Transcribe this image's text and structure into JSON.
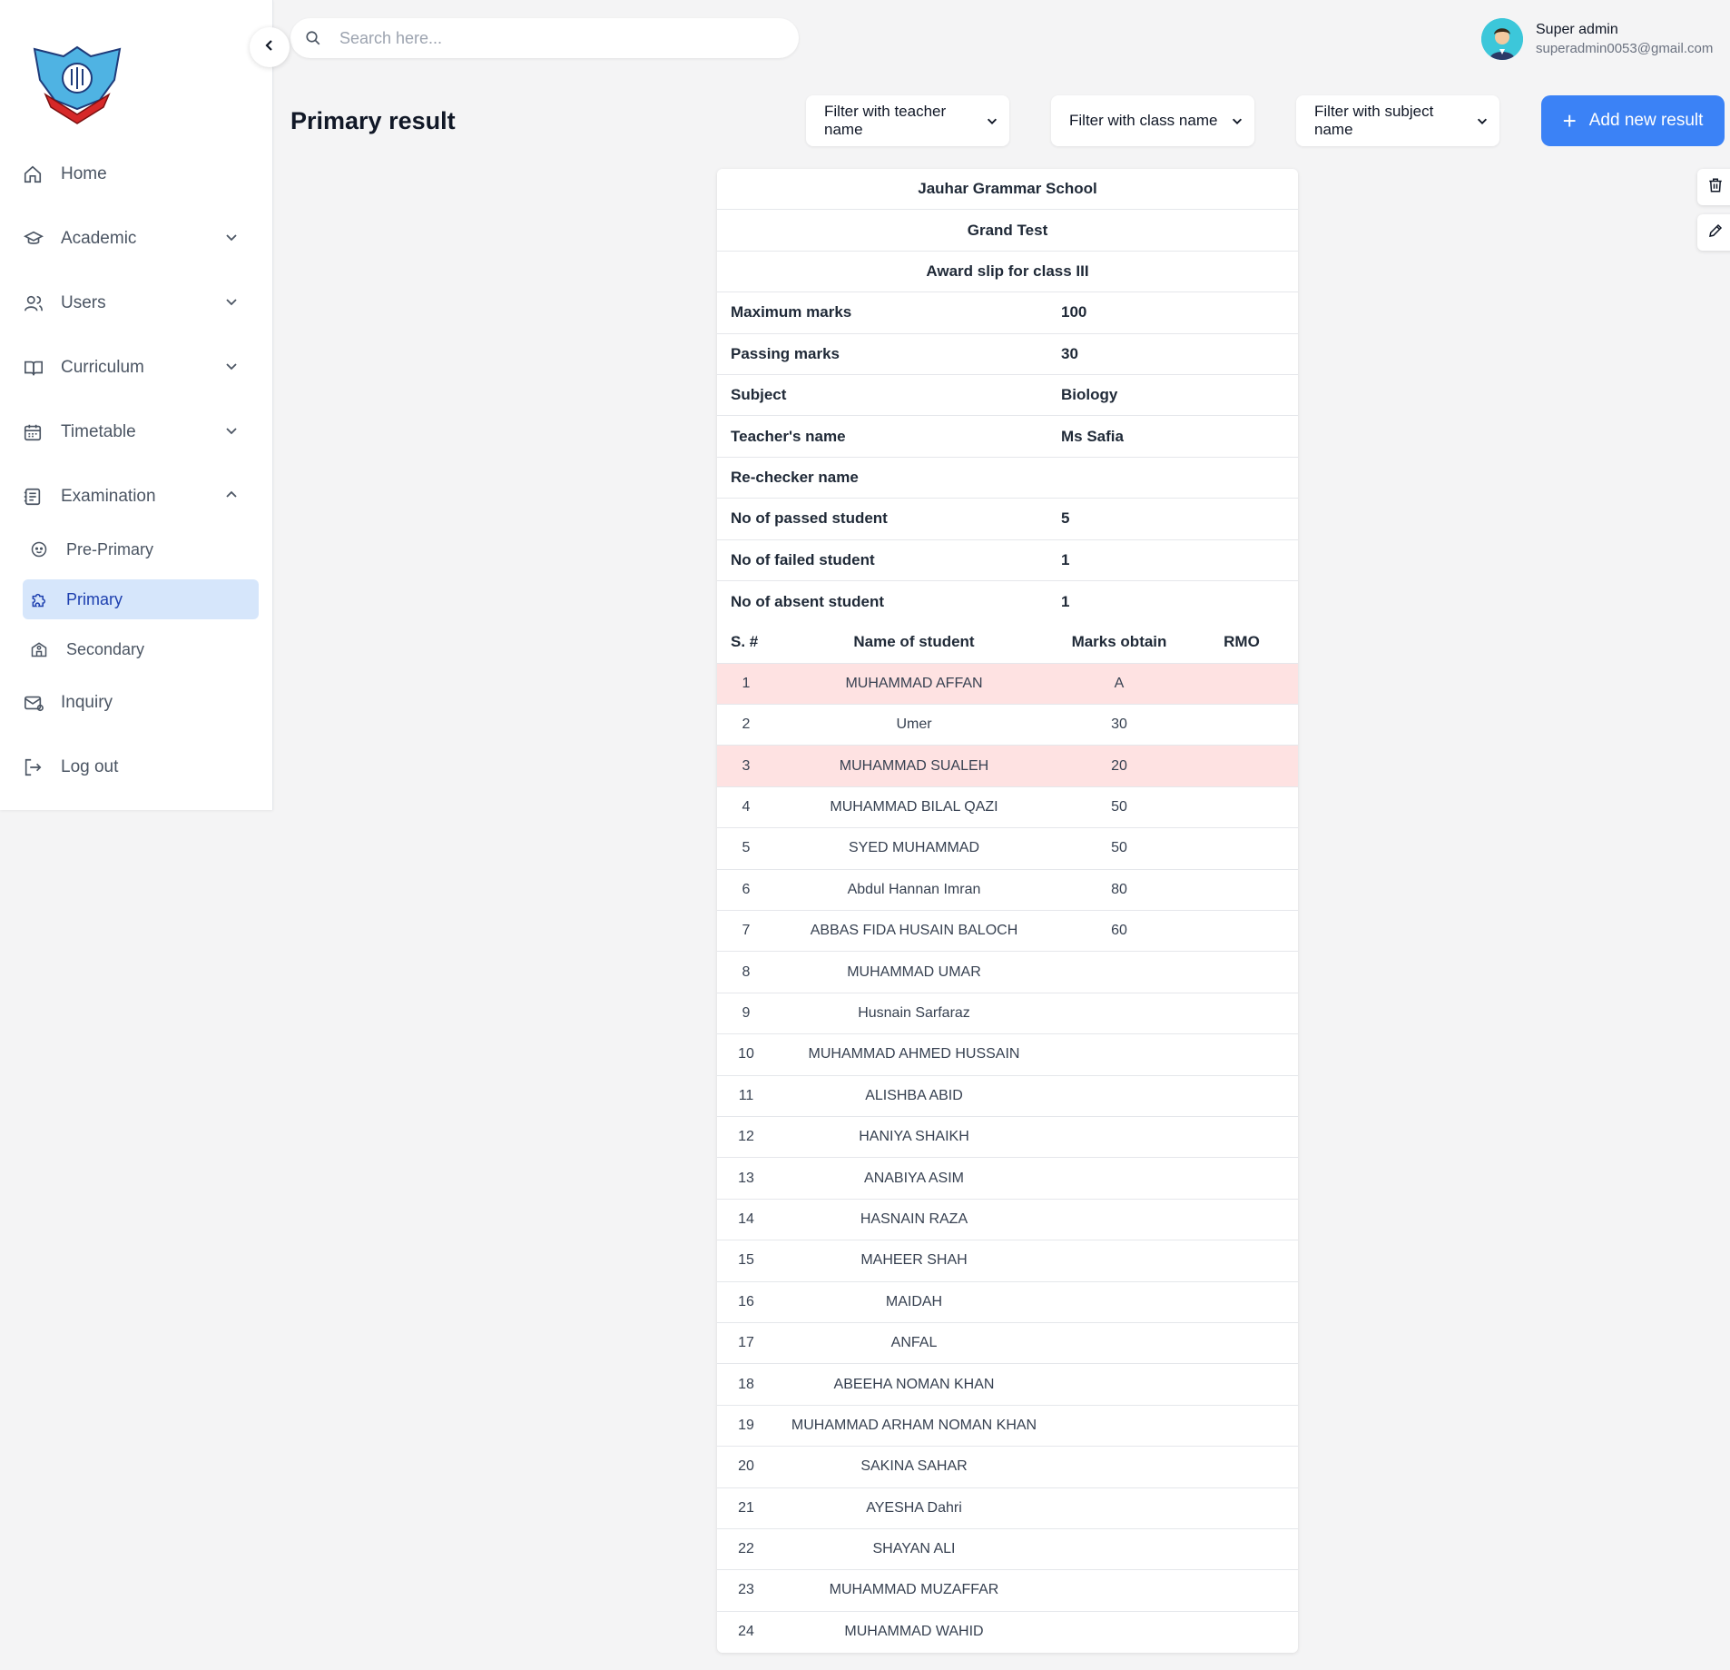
{
  "search": {
    "placeholder": "Search here..."
  },
  "profile": {
    "name": "Super admin",
    "email": "superadmin0053@gmail.com"
  },
  "sidebar": {
    "items": [
      {
        "label": "Home",
        "icon": "home-icon"
      },
      {
        "label": "Academic",
        "icon": "graduation-cap-icon"
      },
      {
        "label": "Users",
        "icon": "users-icon"
      },
      {
        "label": "Curriculum",
        "icon": "book-icon"
      },
      {
        "label": "Timetable",
        "icon": "calendar-icon"
      },
      {
        "label": "Examination",
        "icon": "notebook-icon",
        "expanded": true
      },
      {
        "label": "Inquiry",
        "icon": "mail-icon"
      },
      {
        "label": "Log out",
        "icon": "logout-icon"
      }
    ],
    "examination_sub": [
      {
        "label": "Pre-Primary",
        "icon": "baby-icon"
      },
      {
        "label": "Primary",
        "icon": "puzzle-icon",
        "active": true
      },
      {
        "label": "Secondary",
        "icon": "school-building-icon"
      }
    ]
  },
  "page": {
    "title": "Primary result"
  },
  "filters": {
    "teacher": "Filter with teacher name",
    "class": "Filter with class name",
    "subject": "Filter with subject name"
  },
  "add_button": {
    "label": "Add new result"
  },
  "result": {
    "school": "Jauhar Grammar School",
    "test": "Grand Test",
    "slip": "Award slip for class III",
    "info": [
      {
        "label": "Maximum marks",
        "value": "100"
      },
      {
        "label": "Passing marks",
        "value": "30"
      },
      {
        "label": "Subject",
        "value": "Biology"
      },
      {
        "label": "Teacher's name",
        "value": "Ms Safia"
      },
      {
        "label": "Re-checker name",
        "value": ""
      },
      {
        "label": "No of passed student",
        "value": "5"
      },
      {
        "label": "No of failed student",
        "value": "1"
      },
      {
        "label": "No of absent student",
        "value": "1"
      }
    ],
    "headers": {
      "sno": "S. #",
      "name": "Name of student",
      "marks": "Marks obtain",
      "rmo": "RMO"
    },
    "students": [
      {
        "sno": "1",
        "name": "MUHAMMAD AFFAN",
        "marks": "A",
        "rmo": "",
        "highlight": true
      },
      {
        "sno": "2",
        "name": "Umer",
        "marks": "30",
        "rmo": ""
      },
      {
        "sno": "3",
        "name": "MUHAMMAD SUALEH",
        "marks": "20",
        "rmo": "",
        "highlight": true
      },
      {
        "sno": "4",
        "name": "MUHAMMAD BILAL QAZI",
        "marks": "50",
        "rmo": ""
      },
      {
        "sno": "5",
        "name": "SYED MUHAMMAD",
        "marks": "50",
        "rmo": ""
      },
      {
        "sno": "6",
        "name": "Abdul Hannan Imran",
        "marks": "80",
        "rmo": ""
      },
      {
        "sno": "7",
        "name": "ABBAS FIDA HUSAIN BALOCH",
        "marks": "60",
        "rmo": ""
      },
      {
        "sno": "8",
        "name": "MUHAMMAD UMAR",
        "marks": "",
        "rmo": ""
      },
      {
        "sno": "9",
        "name": "Husnain Sarfaraz",
        "marks": "",
        "rmo": ""
      },
      {
        "sno": "10",
        "name": "MUHAMMAD AHMED HUSSAIN",
        "marks": "",
        "rmo": ""
      },
      {
        "sno": "11",
        "name": "ALISHBA ABID",
        "marks": "",
        "rmo": ""
      },
      {
        "sno": "12",
        "name": "HANIYA SHAIKH",
        "marks": "",
        "rmo": ""
      },
      {
        "sno": "13",
        "name": "ANABIYA ASIM",
        "marks": "",
        "rmo": ""
      },
      {
        "sno": "14",
        "name": "HASNAIN RAZA",
        "marks": "",
        "rmo": ""
      },
      {
        "sno": "15",
        "name": "MAHEER SHAH",
        "marks": "",
        "rmo": ""
      },
      {
        "sno": "16",
        "name": "MAIDAH",
        "marks": "",
        "rmo": ""
      },
      {
        "sno": "17",
        "name": "ANFAL",
        "marks": "",
        "rmo": ""
      },
      {
        "sno": "18",
        "name": "ABEEHA NOMAN KHAN",
        "marks": "",
        "rmo": ""
      },
      {
        "sno": "19",
        "name": "MUHAMMAD ARHAM NOMAN KHAN",
        "marks": "",
        "rmo": ""
      },
      {
        "sno": "20",
        "name": "SAKINA SAHAR",
        "marks": "",
        "rmo": ""
      },
      {
        "sno": "21",
        "name": "AYESHA Dahri",
        "marks": "",
        "rmo": ""
      },
      {
        "sno": "22",
        "name": "SHAYAN ALI",
        "marks": "",
        "rmo": ""
      },
      {
        "sno": "23",
        "name": "MUHAMMAD MUZAFFAR",
        "marks": "",
        "rmo": ""
      },
      {
        "sno": "24",
        "name": "MUHAMMAD WAHID",
        "marks": "",
        "rmo": ""
      }
    ]
  },
  "colors": {
    "accent": "#3b82f6",
    "active_bg": "#d6e6fb",
    "fail_row": "#fee2e2"
  }
}
